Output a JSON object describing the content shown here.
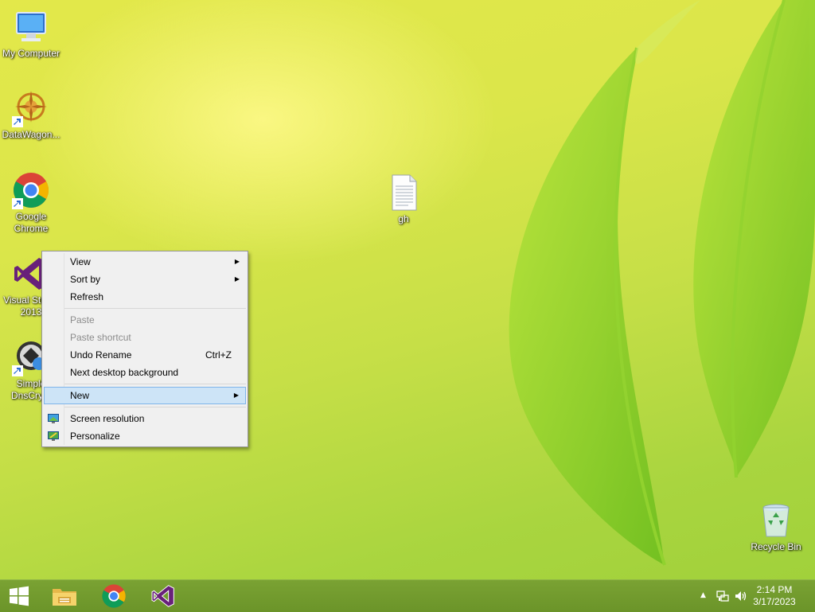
{
  "desktop": {
    "icons": [
      {
        "label": "My Computer"
      },
      {
        "label": "DataWagon..."
      },
      {
        "label": "Google Chrome"
      },
      {
        "label": "Visual Studio 2013"
      },
      {
        "label": "Simple DnsCrypt"
      },
      {
        "label": "gh"
      },
      {
        "label": "Recycle Bin"
      }
    ]
  },
  "context_menu": {
    "items": [
      {
        "label": "View"
      },
      {
        "label": "Sort by"
      },
      {
        "label": "Refresh"
      },
      {
        "label": "Paste"
      },
      {
        "label": "Paste shortcut"
      },
      {
        "label": "Undo Rename",
        "shortcut": "Ctrl+Z"
      },
      {
        "label": "Next desktop background"
      },
      {
        "label": "New"
      },
      {
        "label": "Screen resolution"
      },
      {
        "label": "Personalize"
      }
    ]
  },
  "taskbar": {
    "clock": {
      "time": "2:14 PM",
      "date": "3/17/2023"
    }
  },
  "colors": {
    "taskbar": "#6b9429",
    "menu_background": "#f0f0f0",
    "menu_hover": "#cde4f7",
    "menu_hover_border": "#7eb4ea",
    "vs_purple": "#68217a"
  }
}
